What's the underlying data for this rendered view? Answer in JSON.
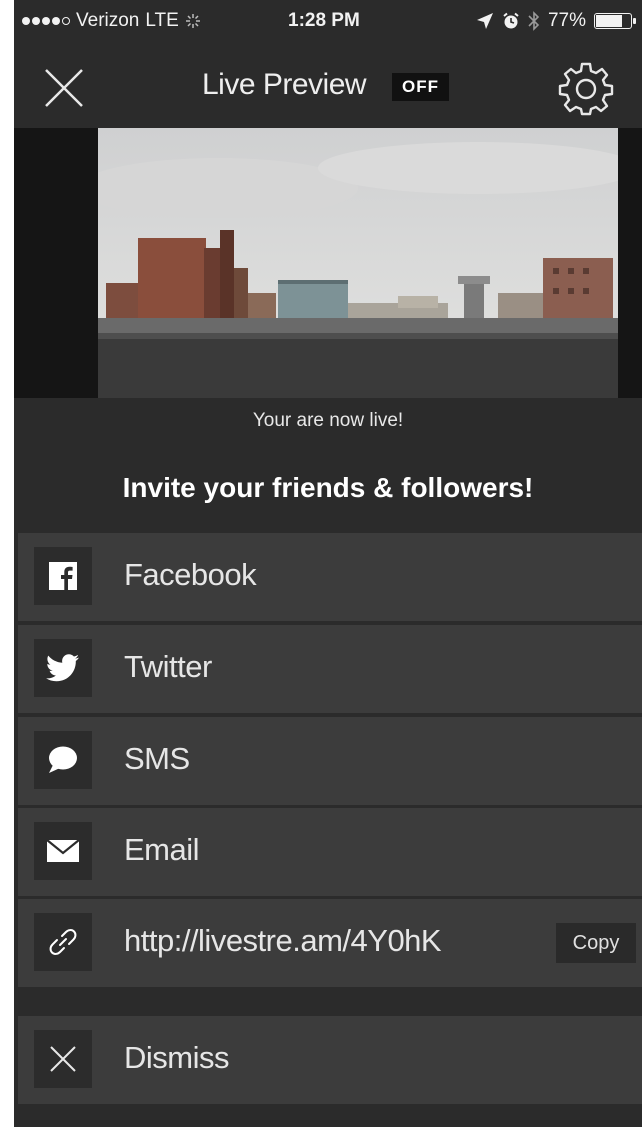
{
  "status_bar": {
    "carrier": "Verizon",
    "network": "LTE",
    "time": "1:28 PM",
    "battery_percent": "77%",
    "battery_level": 0.77,
    "signal_bars": 4,
    "signal_total": 5
  },
  "nav": {
    "title": "Live Preview",
    "badge": "OFF",
    "close_icon": "close-icon",
    "settings_icon": "gear-icon"
  },
  "live_status": "Your are now live!",
  "invite_title": "Invite your friends & followers!",
  "share_options": [
    {
      "label": "Facebook",
      "icon": "facebook-icon"
    },
    {
      "label": "Twitter",
      "icon": "twitter-icon"
    },
    {
      "label": "SMS",
      "icon": "chat-bubble-icon"
    },
    {
      "label": "Email",
      "icon": "envelope-icon"
    },
    {
      "label": "http://livestre.am/4Y0hK",
      "icon": "link-icon",
      "action": "Copy"
    }
  ],
  "dismiss": {
    "label": "Dismiss",
    "icon": "close-icon"
  },
  "colors": {
    "background": "#2b2b2b",
    "row": "#3c3c3c",
    "icon_box": "#2c2c2c",
    "text": "#e6e6e6"
  }
}
